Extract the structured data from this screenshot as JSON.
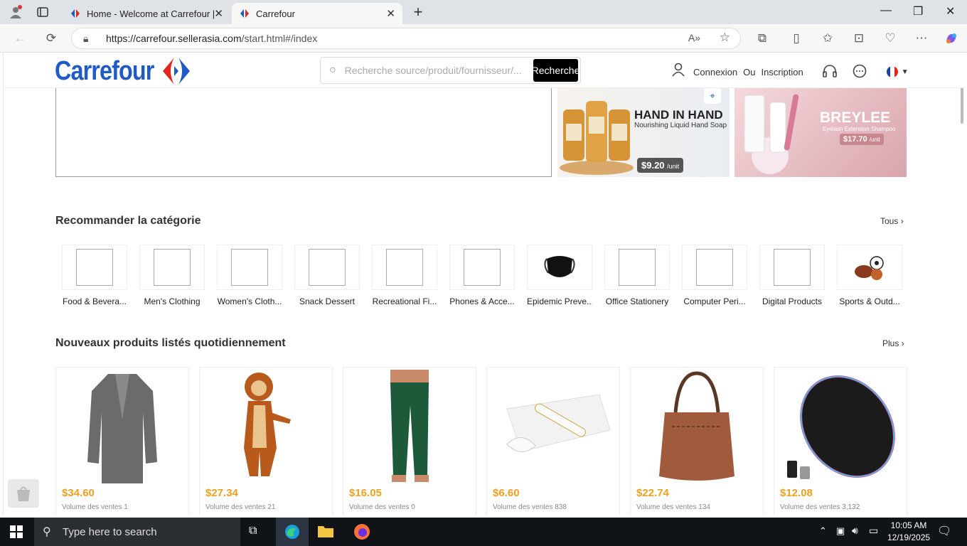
{
  "browser": {
    "tabs": [
      {
        "title": "Home - Welcome at Carrefour | C",
        "active": false
      },
      {
        "title": "Carrefour",
        "active": true
      }
    ],
    "url_host": "https://carrefour.sellerasia.com",
    "url_path": "/start.html#/index"
  },
  "header": {
    "logo_text": "Carrefour",
    "search_placeholder": "Recherche source/produit/fournisseur/...",
    "search_button": "Recherche",
    "login": "Connexion",
    "or": "Ou",
    "register": "Inscription"
  },
  "promos": [
    {
      "headline": "HAND IN HAND",
      "subline": "Nourishing Liquid Hand Soap",
      "price": "$9.20",
      "unit": "/unit"
    },
    {
      "headline": "BREYLEE",
      "subline": "Eyelash Extension Shampoo",
      "price": "$17.70",
      "unit": "/unit"
    }
  ],
  "categories_section": {
    "title": "Recommander la catégorie",
    "more": "Tous",
    "items": [
      {
        "label": "Food & Bevera..."
      },
      {
        "label": "Men's Clothing"
      },
      {
        "label": "Women's Cloth..."
      },
      {
        "label": "Snack Dessert"
      },
      {
        "label": "Recreational Fi..."
      },
      {
        "label": "Phones & Acce..."
      },
      {
        "label": "Epidemic Preve..."
      },
      {
        "label": "Office Stationery"
      },
      {
        "label": "Computer Peri..."
      },
      {
        "label": "Digital Products"
      },
      {
        "label": "Sports & Outd..."
      }
    ]
  },
  "products_section": {
    "title": "Nouveaux produits listés quotidiennement",
    "more": "Plus",
    "items": [
      {
        "price": "$34.60",
        "volume": "Volume des ventes 1"
      },
      {
        "price": "$27.34",
        "volume": "Volume des ventes 21"
      },
      {
        "price": "$16.05",
        "volume": "Volume des ventes 0"
      },
      {
        "price": "$6.60",
        "volume": "Volume des ventes 838"
      },
      {
        "price": "$22.74",
        "volume": "Volume des ventes 134"
      },
      {
        "price": "$12.08",
        "volume": "Volume des ventes 3,132"
      }
    ]
  },
  "taskbar": {
    "search_placeholder": "Type here to search",
    "time": "10:05 AM",
    "date": "12/19/2025"
  },
  "colors": {
    "brand_blue": "#1e5bc6",
    "brand_red": "#e1261c",
    "price_orange": "#f0a020"
  }
}
